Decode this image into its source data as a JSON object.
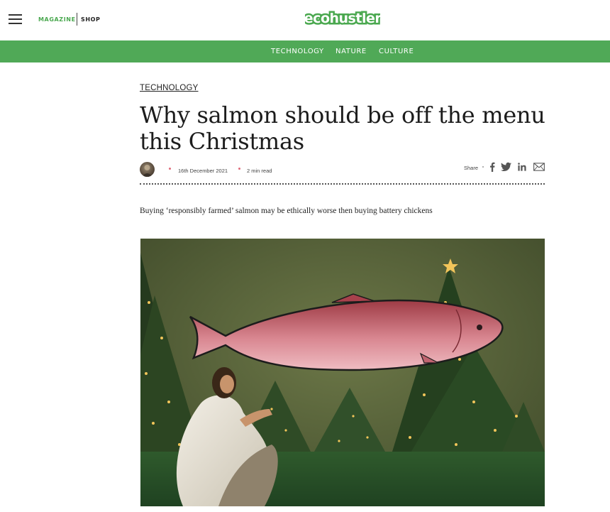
{
  "header": {
    "menu_icon": "hamburger-menu-icon",
    "links": {
      "magazine": "MAGAZINE",
      "shop": "SHOP"
    },
    "logo": "ecohustler",
    "brand_color": "#4aa84f"
  },
  "nav": {
    "background": "#50a957",
    "items": [
      "TECHNOLOGY",
      "NATURE",
      "CULTURE"
    ]
  },
  "article": {
    "category": "TECHNOLOGY",
    "title_line1": "Why salmon should be off the menu",
    "title_line2": "this Christmas",
    "date": "16th December 2021",
    "read_time": "2 min read",
    "share_label": "Share",
    "share_icons": [
      "facebook-icon",
      "twitter-icon",
      "linkedin-icon",
      "email-icon"
    ],
    "standfirst": "Buying ‘responsibly farmed’ salmon may be ethically worse then buying battery chickens",
    "hero_image": "collage-salmon-over-christmas-trees-with-praying-figure"
  }
}
